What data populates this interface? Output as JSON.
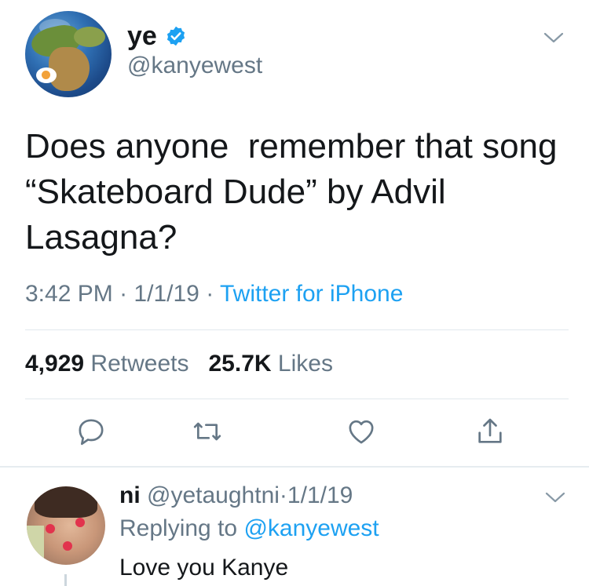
{
  "tweet": {
    "author": {
      "name": "ye",
      "handle": "@kanyewest",
      "verified": true,
      "avatar": "earth-globe-avatar"
    },
    "text": "Does anyone  remember that song “Skateboard Dude” by Advil Lasagna?",
    "time": "3:42 PM",
    "separator": "·",
    "date": "1/1/19",
    "source": "Twitter for iPhone",
    "stats": {
      "retweets_count": "4,929",
      "retweets_label": "Retweets",
      "likes_count": "25.7K",
      "likes_label": "Likes"
    },
    "actions": [
      "reply-icon",
      "retweet-icon",
      "like-icon",
      "share-icon"
    ]
  },
  "reply": {
    "name": "ni",
    "handle": "@yetaughtni",
    "separator": "·",
    "date": "1/1/19",
    "replying_prefix": "Replying to",
    "replying_to": "@kanyewest",
    "text": "Love you Kanye"
  },
  "colors": {
    "accent": "#1da1f2",
    "text": "#14171a",
    "secondary": "#657786",
    "divider": "#e1e8ed"
  }
}
